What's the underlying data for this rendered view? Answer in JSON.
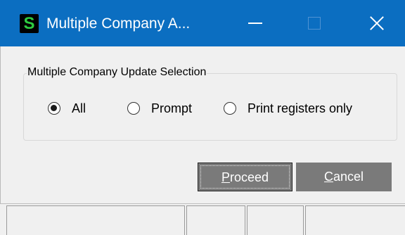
{
  "window": {
    "title": "Multiple Company A...",
    "app_icon_letter": "S",
    "controls": {
      "minimize_icon": "minimize-icon",
      "maximize_icon": "maximize-icon",
      "close_icon": "close-icon"
    }
  },
  "group": {
    "label": "Multiple Company Update Selection",
    "options": [
      {
        "label": "All",
        "selected": true
      },
      {
        "label": "Prompt",
        "selected": false
      },
      {
        "label": "Print registers only",
        "selected": false
      }
    ]
  },
  "buttons": {
    "proceed": {
      "accel": "P",
      "rest": "roceed"
    },
    "cancel": {
      "accel": "C",
      "rest": "ancel"
    }
  },
  "colors": {
    "titlebar": "#0b6ec1",
    "app_icon_bg": "#000000",
    "app_icon_fg": "#2ecc40",
    "button_bg": "#7a7a7a",
    "window_bg": "#f0f0f0"
  },
  "statusbar": {
    "cells": [
      "",
      "",
      "",
      ""
    ]
  }
}
